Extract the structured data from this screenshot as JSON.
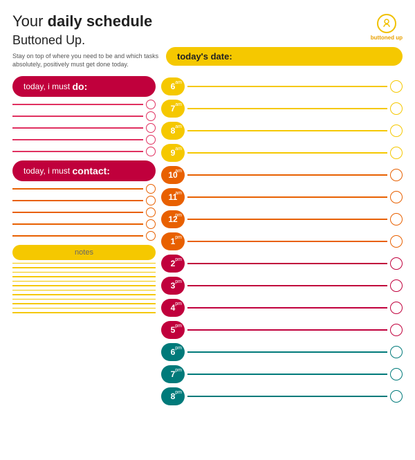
{
  "header": {
    "title_prefix": "Your ",
    "title_bold": "daily schedule",
    "brand": "Buttoned Up.",
    "subtitle": "Stay on top of where you need to be and which tasks absolutely, positively must get done today.",
    "logo_text": "buttoned up",
    "date_label": "today's date:"
  },
  "left": {
    "do_label_prefix": "today, i must ",
    "do_label_bold": "do:",
    "contact_label_prefix": "today, i must ",
    "contact_label_bold": "contact:",
    "notes_label": "notes",
    "do_lines": 5,
    "contact_lines": 5,
    "note_lines": 12
  },
  "schedule": {
    "slots": [
      {
        "hour": "6",
        "ampm": "am",
        "color": "yellow"
      },
      {
        "hour": "7",
        "ampm": "am",
        "color": "yellow"
      },
      {
        "hour": "8",
        "ampm": "am",
        "color": "yellow"
      },
      {
        "hour": "9",
        "ampm": "am",
        "color": "yellow"
      },
      {
        "hour": "10",
        "ampm": "am",
        "color": "orange"
      },
      {
        "hour": "11",
        "ampm": "am",
        "color": "orange"
      },
      {
        "hour": "12",
        "ampm": "pm",
        "color": "orange"
      },
      {
        "hour": "1",
        "ampm": "pm",
        "color": "orange"
      },
      {
        "hour": "2",
        "ampm": "pm",
        "color": "red"
      },
      {
        "hour": "3",
        "ampm": "pm",
        "color": "red"
      },
      {
        "hour": "4",
        "ampm": "pm",
        "color": "red"
      },
      {
        "hour": "5",
        "ampm": "pm",
        "color": "red"
      },
      {
        "hour": "6",
        "ampm": "pm",
        "color": "teal"
      },
      {
        "hour": "7",
        "ampm": "pm",
        "color": "teal"
      },
      {
        "hour": "8",
        "ampm": "pm",
        "color": "teal"
      }
    ]
  }
}
